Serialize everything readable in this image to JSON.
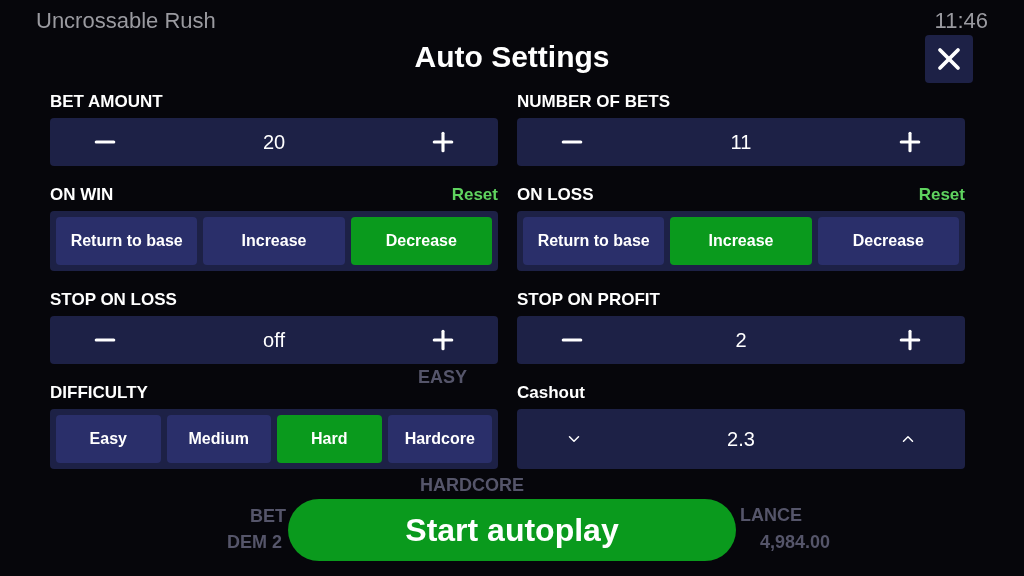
{
  "status_bar": {
    "app_name": "Uncrossable Rush",
    "time": "11:46"
  },
  "background_labels": [
    {
      "text": "EASY"
    },
    {
      "text": "HARDCORE"
    },
    {
      "text": "BET"
    },
    {
      "text": "DEM 2"
    },
    {
      "text": "LANCE"
    },
    {
      "text": "4,984.00"
    }
  ],
  "dialog": {
    "title": "Auto Settings",
    "fields": [
      {
        "label": "BET AMOUNT",
        "kind": "stepper",
        "value": "20"
      },
      {
        "label": "NUMBER OF BETS",
        "kind": "stepper",
        "value": "11"
      },
      {
        "label": "ON WIN",
        "kind": "options",
        "reset": "Reset",
        "options": [
          {
            "label": "Return to base",
            "selected": false
          },
          {
            "label": "Increase",
            "selected": false
          },
          {
            "label": "Decrease",
            "selected": true
          }
        ]
      },
      {
        "label": "ON LOSS",
        "kind": "options",
        "reset": "Reset",
        "options": [
          {
            "label": "Return to base",
            "selected": false
          },
          {
            "label": "Increase",
            "selected": true
          },
          {
            "label": "Decrease",
            "selected": false
          }
        ]
      },
      {
        "label": "STOP ON LOSS",
        "kind": "stepper",
        "value": "off"
      },
      {
        "label": "STOP ON PROFIT",
        "kind": "stepper",
        "value": "2"
      },
      {
        "label": "DIFFICULTY",
        "kind": "options",
        "options": [
          {
            "label": "Easy",
            "selected": false
          },
          {
            "label": "Medium",
            "selected": false
          },
          {
            "label": "Hard",
            "selected": true
          },
          {
            "label": "Hardcore",
            "selected": false
          }
        ]
      },
      {
        "label": "Cashout",
        "kind": "select",
        "value": "2.3"
      }
    ],
    "start_button": "Start autoplay"
  }
}
